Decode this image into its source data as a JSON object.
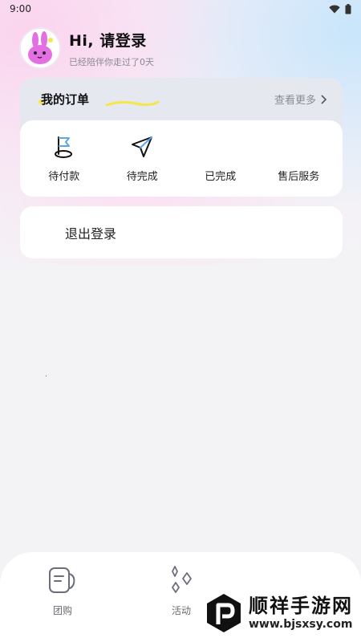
{
  "status_bar": {
    "time": "9:00",
    "icons": [
      "wifi-icon",
      "battery-icon"
    ]
  },
  "header": {
    "title": "Hi, 请登录",
    "subtitle": "已经陪伴你走过了0天",
    "avatar_icon": "bunny-avatar-icon"
  },
  "orders": {
    "title": "我的订单",
    "more_label": "查看更多",
    "items": [
      {
        "label": "待付款",
        "icon": "flag-icon"
      },
      {
        "label": "待完成",
        "icon": "paper-plane-icon"
      },
      {
        "label": "已完成",
        "icon": ""
      },
      {
        "label": "售后服务",
        "icon": ""
      }
    ]
  },
  "logout_label": "退出登录",
  "tabbar": {
    "items": [
      {
        "label": "团购",
        "icon": "document-icon"
      },
      {
        "label": "活动",
        "icon": "sparkle-icon"
      }
    ]
  },
  "watermark": {
    "title": "顺祥手游网",
    "url": "www.bjsxsy.com"
  },
  "colors": {
    "accent_blue": "#5aa6e6",
    "accent_yellow": "#f5e74a",
    "background": "#f3f3f6"
  }
}
